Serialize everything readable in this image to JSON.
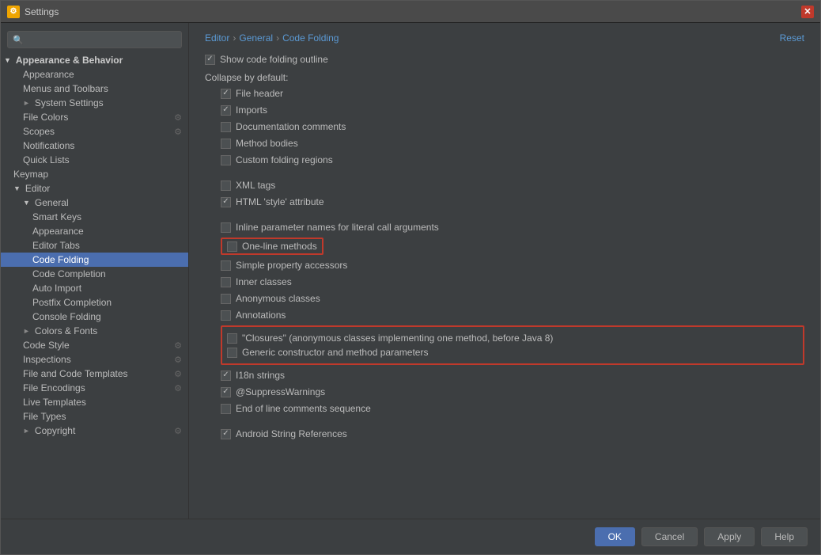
{
  "window": {
    "title": "Settings",
    "icon": "⚙"
  },
  "search": {
    "placeholder": ""
  },
  "breadcrumb": {
    "parts": [
      "Editor",
      "General",
      "Code Folding"
    ],
    "separator": "›",
    "reset_label": "Reset"
  },
  "sidebar": {
    "items": [
      {
        "id": "appearance-behavior",
        "label": "Appearance & Behavior",
        "level": "category",
        "expanded": true,
        "triangle": "▼"
      },
      {
        "id": "appearance",
        "label": "Appearance",
        "level": "level2"
      },
      {
        "id": "menus-toolbars",
        "label": "Menus and Toolbars",
        "level": "level2"
      },
      {
        "id": "system-settings",
        "label": "System Settings",
        "level": "level2",
        "triangle": "►"
      },
      {
        "id": "file-colors",
        "label": "File Colors",
        "level": "level2",
        "has-icon": true
      },
      {
        "id": "scopes",
        "label": "Scopes",
        "level": "level2",
        "has-icon": true
      },
      {
        "id": "notifications",
        "label": "Notifications",
        "level": "level2"
      },
      {
        "id": "quick-lists",
        "label": "Quick Lists",
        "level": "level2"
      },
      {
        "id": "keymap",
        "label": "Keymap",
        "level": "level1"
      },
      {
        "id": "editor",
        "label": "Editor",
        "level": "level1",
        "expanded": true,
        "triangle": "▼"
      },
      {
        "id": "general",
        "label": "General",
        "level": "level2",
        "expanded": true,
        "triangle": "▼"
      },
      {
        "id": "smart-keys",
        "label": "Smart Keys",
        "level": "level3"
      },
      {
        "id": "appearance-editor",
        "label": "Appearance",
        "level": "level3"
      },
      {
        "id": "editor-tabs",
        "label": "Editor Tabs",
        "level": "level3"
      },
      {
        "id": "code-folding",
        "label": "Code Folding",
        "level": "level3",
        "active": true
      },
      {
        "id": "code-completion",
        "label": "Code Completion",
        "level": "level3"
      },
      {
        "id": "auto-import",
        "label": "Auto Import",
        "level": "level3"
      },
      {
        "id": "postfix-completion",
        "label": "Postfix Completion",
        "level": "level3"
      },
      {
        "id": "console-folding",
        "label": "Console Folding",
        "level": "level3"
      },
      {
        "id": "colors-fonts",
        "label": "Colors & Fonts",
        "level": "level2",
        "triangle": "►"
      },
      {
        "id": "code-style",
        "label": "Code Style",
        "level": "level2",
        "has-icon": true
      },
      {
        "id": "inspections",
        "label": "Inspections",
        "level": "level2",
        "has-icon": true
      },
      {
        "id": "file-code-templates",
        "label": "File and Code Templates",
        "level": "level2",
        "has-icon": true
      },
      {
        "id": "file-encodings",
        "label": "File Encodings",
        "level": "level2",
        "has-icon": true
      },
      {
        "id": "live-templates",
        "label": "Live Templates",
        "level": "level2"
      },
      {
        "id": "file-types",
        "label": "File Types",
        "level": "level2"
      },
      {
        "id": "copyright",
        "label": "Copyright",
        "level": "level2",
        "triangle": "►",
        "has-icon": true
      }
    ]
  },
  "content": {
    "show_folding_outline": {
      "label": "Show code folding outline",
      "checked": true
    },
    "collapse_by_default_label": "Collapse by default:",
    "checkboxes": [
      {
        "id": "file-header",
        "label": "File header",
        "checked": true,
        "indented": true
      },
      {
        "id": "imports",
        "label": "Imports",
        "checked": true,
        "indented": true
      },
      {
        "id": "doc-comments",
        "label": "Documentation comments",
        "checked": false,
        "indented": true
      },
      {
        "id": "method-bodies",
        "label": "Method bodies",
        "checked": false,
        "indented": true
      },
      {
        "id": "custom-folding",
        "label": "Custom folding regions",
        "checked": false,
        "indented": true
      },
      {
        "id": "xml-tags",
        "label": "XML tags",
        "checked": false,
        "indented": true
      },
      {
        "id": "html-style",
        "label": "HTML 'style' attribute",
        "checked": true,
        "indented": true
      },
      {
        "id": "inline-param",
        "label": "Inline parameter names for literal call arguments",
        "checked": false,
        "indented": true
      },
      {
        "id": "one-line-methods",
        "label": "One-line methods",
        "checked": false,
        "indented": true,
        "highlighted": true
      },
      {
        "id": "simple-property",
        "label": "Simple property accessors",
        "checked": false,
        "indented": true
      },
      {
        "id": "inner-classes",
        "label": "Inner classes",
        "checked": false,
        "indented": true
      },
      {
        "id": "anonymous-classes",
        "label": "Anonymous classes",
        "checked": false,
        "indented": true
      },
      {
        "id": "annotations",
        "label": "Annotations",
        "checked": false,
        "indented": true
      },
      {
        "id": "closures",
        "label": "\"Closures\" (anonymous classes implementing one method, before Java 8)",
        "checked": false,
        "indented": true,
        "highlighted": true
      },
      {
        "id": "generic-constructor",
        "label": "Generic constructor and method parameters",
        "checked": false,
        "indented": true,
        "highlighted": true
      },
      {
        "id": "i18n-strings",
        "label": "I18n strings",
        "checked": true,
        "indented": true
      },
      {
        "id": "suppress-warnings",
        "label": "@SuppressWarnings",
        "checked": true,
        "indented": true
      },
      {
        "id": "end-of-line",
        "label": "End of line comments sequence",
        "checked": false,
        "indented": true
      },
      {
        "id": "android-strings",
        "label": "Android String References",
        "checked": true,
        "indented": true
      }
    ]
  },
  "footer": {
    "ok_label": "OK",
    "cancel_label": "Cancel",
    "apply_label": "Apply",
    "help_label": "Help"
  }
}
